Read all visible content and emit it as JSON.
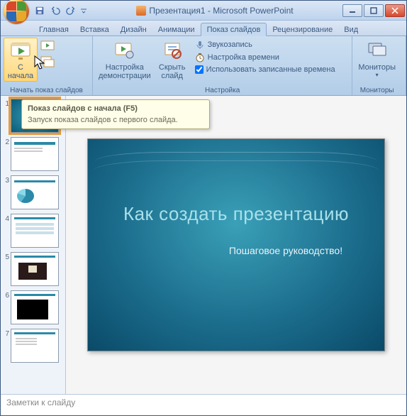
{
  "window": {
    "doc_name": "Презентация1",
    "app_name": "Microsoft PowerPoint"
  },
  "tabs": {
    "home": "Главная",
    "insert": "Вставка",
    "design": "Дизайн",
    "animations": "Анимации",
    "slideshow": "Показ слайдов",
    "review": "Рецензирование",
    "view": "Вид"
  },
  "ribbon": {
    "start_group_label": "Начать показ слайдов",
    "from_beginning": "С\nначала",
    "from_current": "",
    "custom_show": "",
    "setup_group_label": "Настройка",
    "setup_label": "Настройка\nдемонстрации",
    "hide_label": "Скрыть\nслайд",
    "record_label": "Звукозапись",
    "rehearse_label": "Настройка времени",
    "use_rehearsed_label": "Использовать записанные времена",
    "monitors_group_label": "Мониторы",
    "monitors_btn": "Мониторы"
  },
  "tooltip": {
    "title": "Показ слайдов с начала (F5)",
    "body": "Запуск показа слайдов с первого слайда."
  },
  "slide": {
    "title": "Как создать презентацию",
    "subtitle": "Пошаговое руководство!"
  },
  "thumbs": {
    "numbers": [
      "1",
      "2",
      "3",
      "4",
      "5",
      "6",
      "7"
    ]
  },
  "notes": {
    "placeholder": "Заметки к слайду"
  }
}
